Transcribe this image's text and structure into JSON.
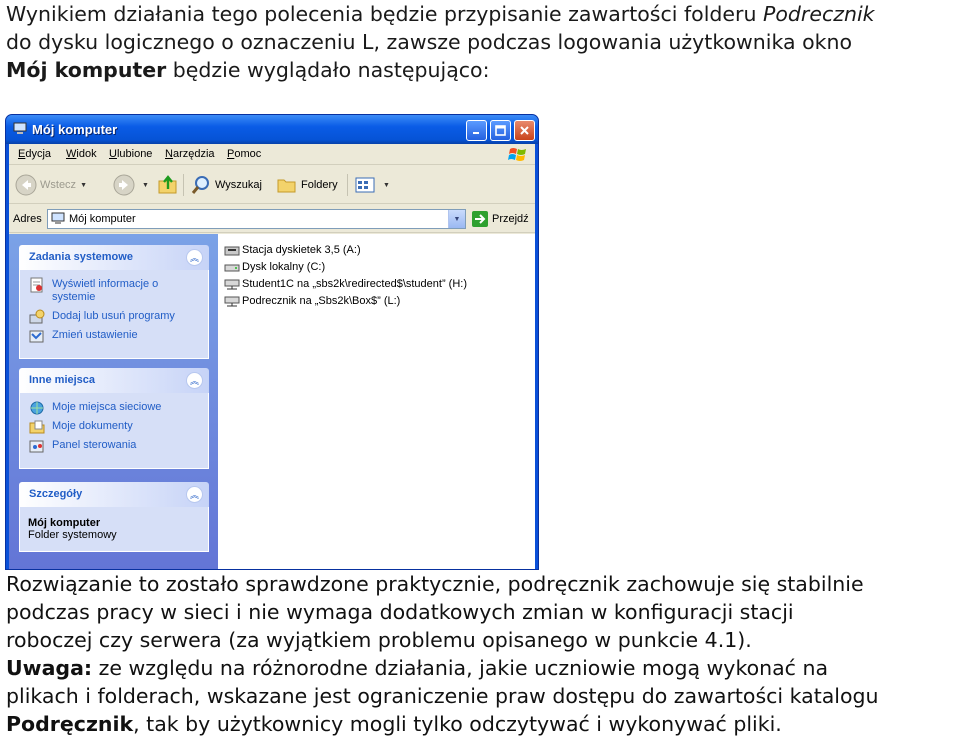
{
  "intro": {
    "line1_text": "Wynikiem działania tego polecenia będzie przypisanie zawartości folderu ",
    "line1_italic": "Podrecznik",
    "line2_text": "do dysku logicznego o oznaczeniu L, zawsze podczas logowania użytkownika okno",
    "line3_bold": "Mój komputer",
    "line3_text": " będzie wyglądało następująco:"
  },
  "window": {
    "title": "Mój komputer",
    "menu": [
      "Edycja",
      "Widok",
      "Ulubione",
      "Narzędzia",
      "Pomoc"
    ],
    "toolbar": {
      "back_label": "Wstecz",
      "search_label": "Wyszukaj",
      "folders_label": "Foldery"
    },
    "address": {
      "label": "Adres",
      "value": "Mój komputer",
      "go_label": "Przejdź"
    },
    "panels": {
      "tasks": {
        "title": "Zadania systemowe",
        "links": [
          "Wyświetl informacje o systemie",
          "Dodaj lub usuń programy",
          "Zmień ustawienie"
        ]
      },
      "places": {
        "title": "Inne miejsca",
        "links": [
          "Moje miejsca sieciowe",
          "Moje dokumenty",
          "Panel sterowania"
        ]
      },
      "details": {
        "title": "Szczegóły",
        "name": "Mój komputer",
        "type": "Folder systemowy"
      }
    },
    "drives": [
      "Stacja dyskietek 3,5 (A:)",
      "Dysk lokalny (C:)",
      "Student1C na „sbs2k\\redirected$\\student” (H:)",
      "Podrecznik na „Sbs2k\\Box$” (L:)"
    ],
    "colors": {
      "titlebar": "#0a5ce6",
      "sidebar": "#7ba2e7",
      "link": "#215dc6"
    }
  },
  "conclusion": {
    "line1": "Rozwiązanie to zostało sprawdzone praktycznie, podręcznik zachowuje się stabilnie",
    "line2": "podczas pracy w sieci i nie wymaga dodatkowych zmian w konfiguracji stacji",
    "line3": "roboczej czy serwera (za wyjątkiem problemu opisanego w punkcie 4.1).",
    "note_label": "Uwaga:",
    "note_line1": " ze względu na różnorodne działania, jakie uczniowie mogą wykonać na",
    "note_line2": "plikach i folderach, wskazane jest ograniczenie praw dostępu do zawartości katalogu",
    "note_bold": "Podręcznik",
    "note_line3": ", tak by użytkownicy mogli tylko odczytywać i wykonywać pliki."
  }
}
